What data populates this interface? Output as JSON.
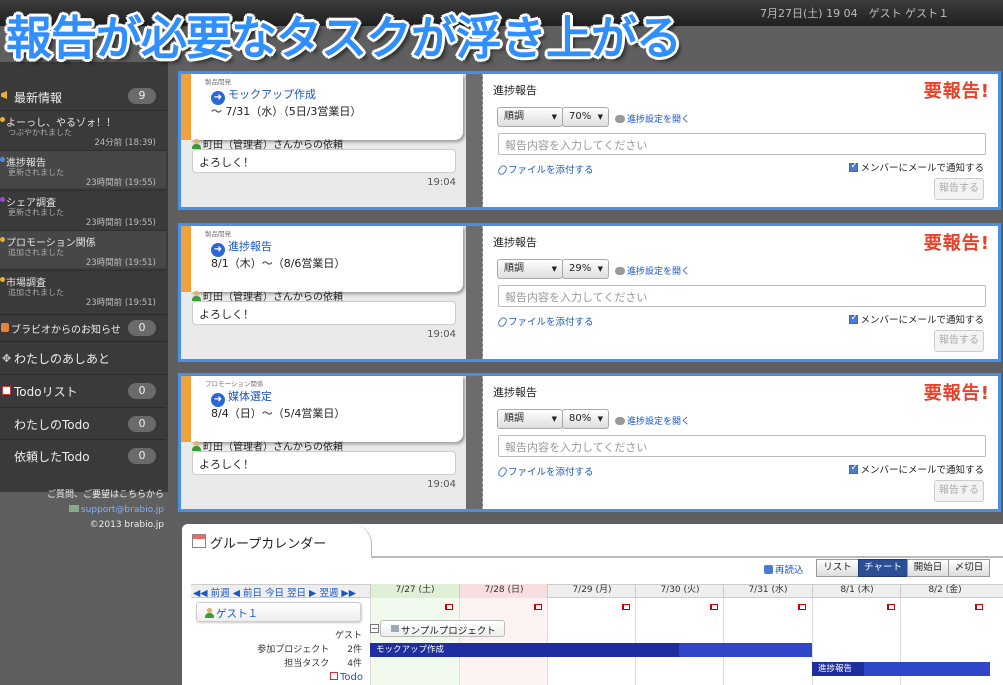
{
  "headline": "報告が必要なタスクが浮き上がる",
  "topbar": {
    "datetime": "7月27日(土) 19 04",
    "user": "ゲスト１"
  },
  "sidebar": {
    "latest": {
      "label": "最新情報",
      "count": "9"
    },
    "news": [
      {
        "title": "よーっし、やるゾォ！！",
        "sub": "つぶやかれました",
        "time": "24分前 (18:39)",
        "color": "#e8b03a"
      },
      {
        "title": "進捗報告",
        "sub": "更新されました",
        "time": "23時間前 (19:55)",
        "color": "#4a90e2"
      },
      {
        "title": "シェア調査",
        "sub": "更新されました",
        "time": "23時間前 (19:55)",
        "color": "#9b4ad0"
      },
      {
        "title": "プロモーション関係",
        "sub": "追加されました",
        "time": "23時間前 (19:51)",
        "color": "#e8b03a"
      },
      {
        "title": "市場調査",
        "sub": "追加されました",
        "time": "23時間前 (19:51)",
        "color": "#e8b03a"
      }
    ],
    "notice": {
      "label": "ブラビオからのお知らせ",
      "count": "0"
    },
    "footprint": {
      "label": "わたしのあしあと"
    },
    "todo": {
      "label": "Todoリスト",
      "count": "0"
    },
    "my_todo": {
      "label": "わたしのTodo",
      "count": "0"
    },
    "req_todo": {
      "label": "依頼したTodo",
      "count": "0"
    },
    "footer": {
      "question": "ご質問、ご要望はこちらから",
      "email": "support@brabio.jp",
      "copyright": "©2013 brabio.jp"
    }
  },
  "tasks": [
    {
      "project": "製品開発",
      "title": "モックアップ作成",
      "dates": "～ 7/31（水）（5日/3営業日）",
      "requester": "町田（管理者）さんからの依頼",
      "message": "よろしく！",
      "msg_time": "19:04",
      "panel_title": "進捗報告",
      "need": "要報告!",
      "status": "順調",
      "percent": "70%",
      "settings_link": "進捗設定を開く",
      "placeholder": "報告内容を入力してください",
      "attach": "ファイルを添付する",
      "notify": "メンバーにメールで通知する",
      "send": "報告する"
    },
    {
      "project": "製品開発",
      "title": "進捗報告",
      "dates": "8/1（木）～（8/6営業日）",
      "requester": "町田（管理者）さんからの依頼",
      "message": "よろしく！",
      "msg_time": "19:04",
      "panel_title": "進捗報告",
      "need": "要報告!",
      "status": "順調",
      "percent": "29%",
      "settings_link": "進捗設定を開く",
      "placeholder": "報告内容を入力してください",
      "attach": "ファイルを添付する",
      "notify": "メンバーにメールで通知する",
      "send": "報告する"
    },
    {
      "project": "プロモーション関係",
      "title": "媒体選定",
      "dates": "8/4（日）～（5/4営業日）",
      "requester": "町田（管理者）さんからの依頼",
      "message": "よろしく！",
      "msg_time": "19:04",
      "panel_title": "進捗報告",
      "need": "要報告!",
      "status": "順調",
      "percent": "80%",
      "settings_link": "進捗設定を開く",
      "placeholder": "報告内容を入力してください",
      "attach": "ファイルを添付する",
      "notify": "メンバーにメールで通知する",
      "send": "報告する"
    }
  ],
  "calendar": {
    "title": "グループカレンダー",
    "reload": "再読込",
    "views": [
      "リスト",
      "チャート",
      "開始日",
      "〆切日"
    ],
    "active_view": "チャート",
    "nav": "◀◀ 前週 ◀ 前日 今日 翌日 ▶ 翌週 ▶▶",
    "days": [
      "7/27 (土)",
      "7/28 (日)",
      "7/29 (月)",
      "7/30 (火)",
      "7/31 (水)",
      "8/1 (木)",
      "8/2 (金)"
    ],
    "guest": "ゲスト１",
    "guest_label": "ゲスト",
    "joined_label": "参加プロジェクト",
    "joined_count": "2件",
    "task_label": "担当タスク",
    "task_count": "4件",
    "todo_label": "Todo",
    "project": "サンプルプロジェクト",
    "bars": [
      {
        "label": "モックアップ作成",
        "progress": 70
      },
      {
        "label": "進捗報告",
        "progress": 29
      }
    ]
  },
  "colors": {
    "accent": "#4a90e2",
    "need": "#e8432a",
    "gantt": "#1f2e9e",
    "task_tab": "#f0a33a"
  }
}
